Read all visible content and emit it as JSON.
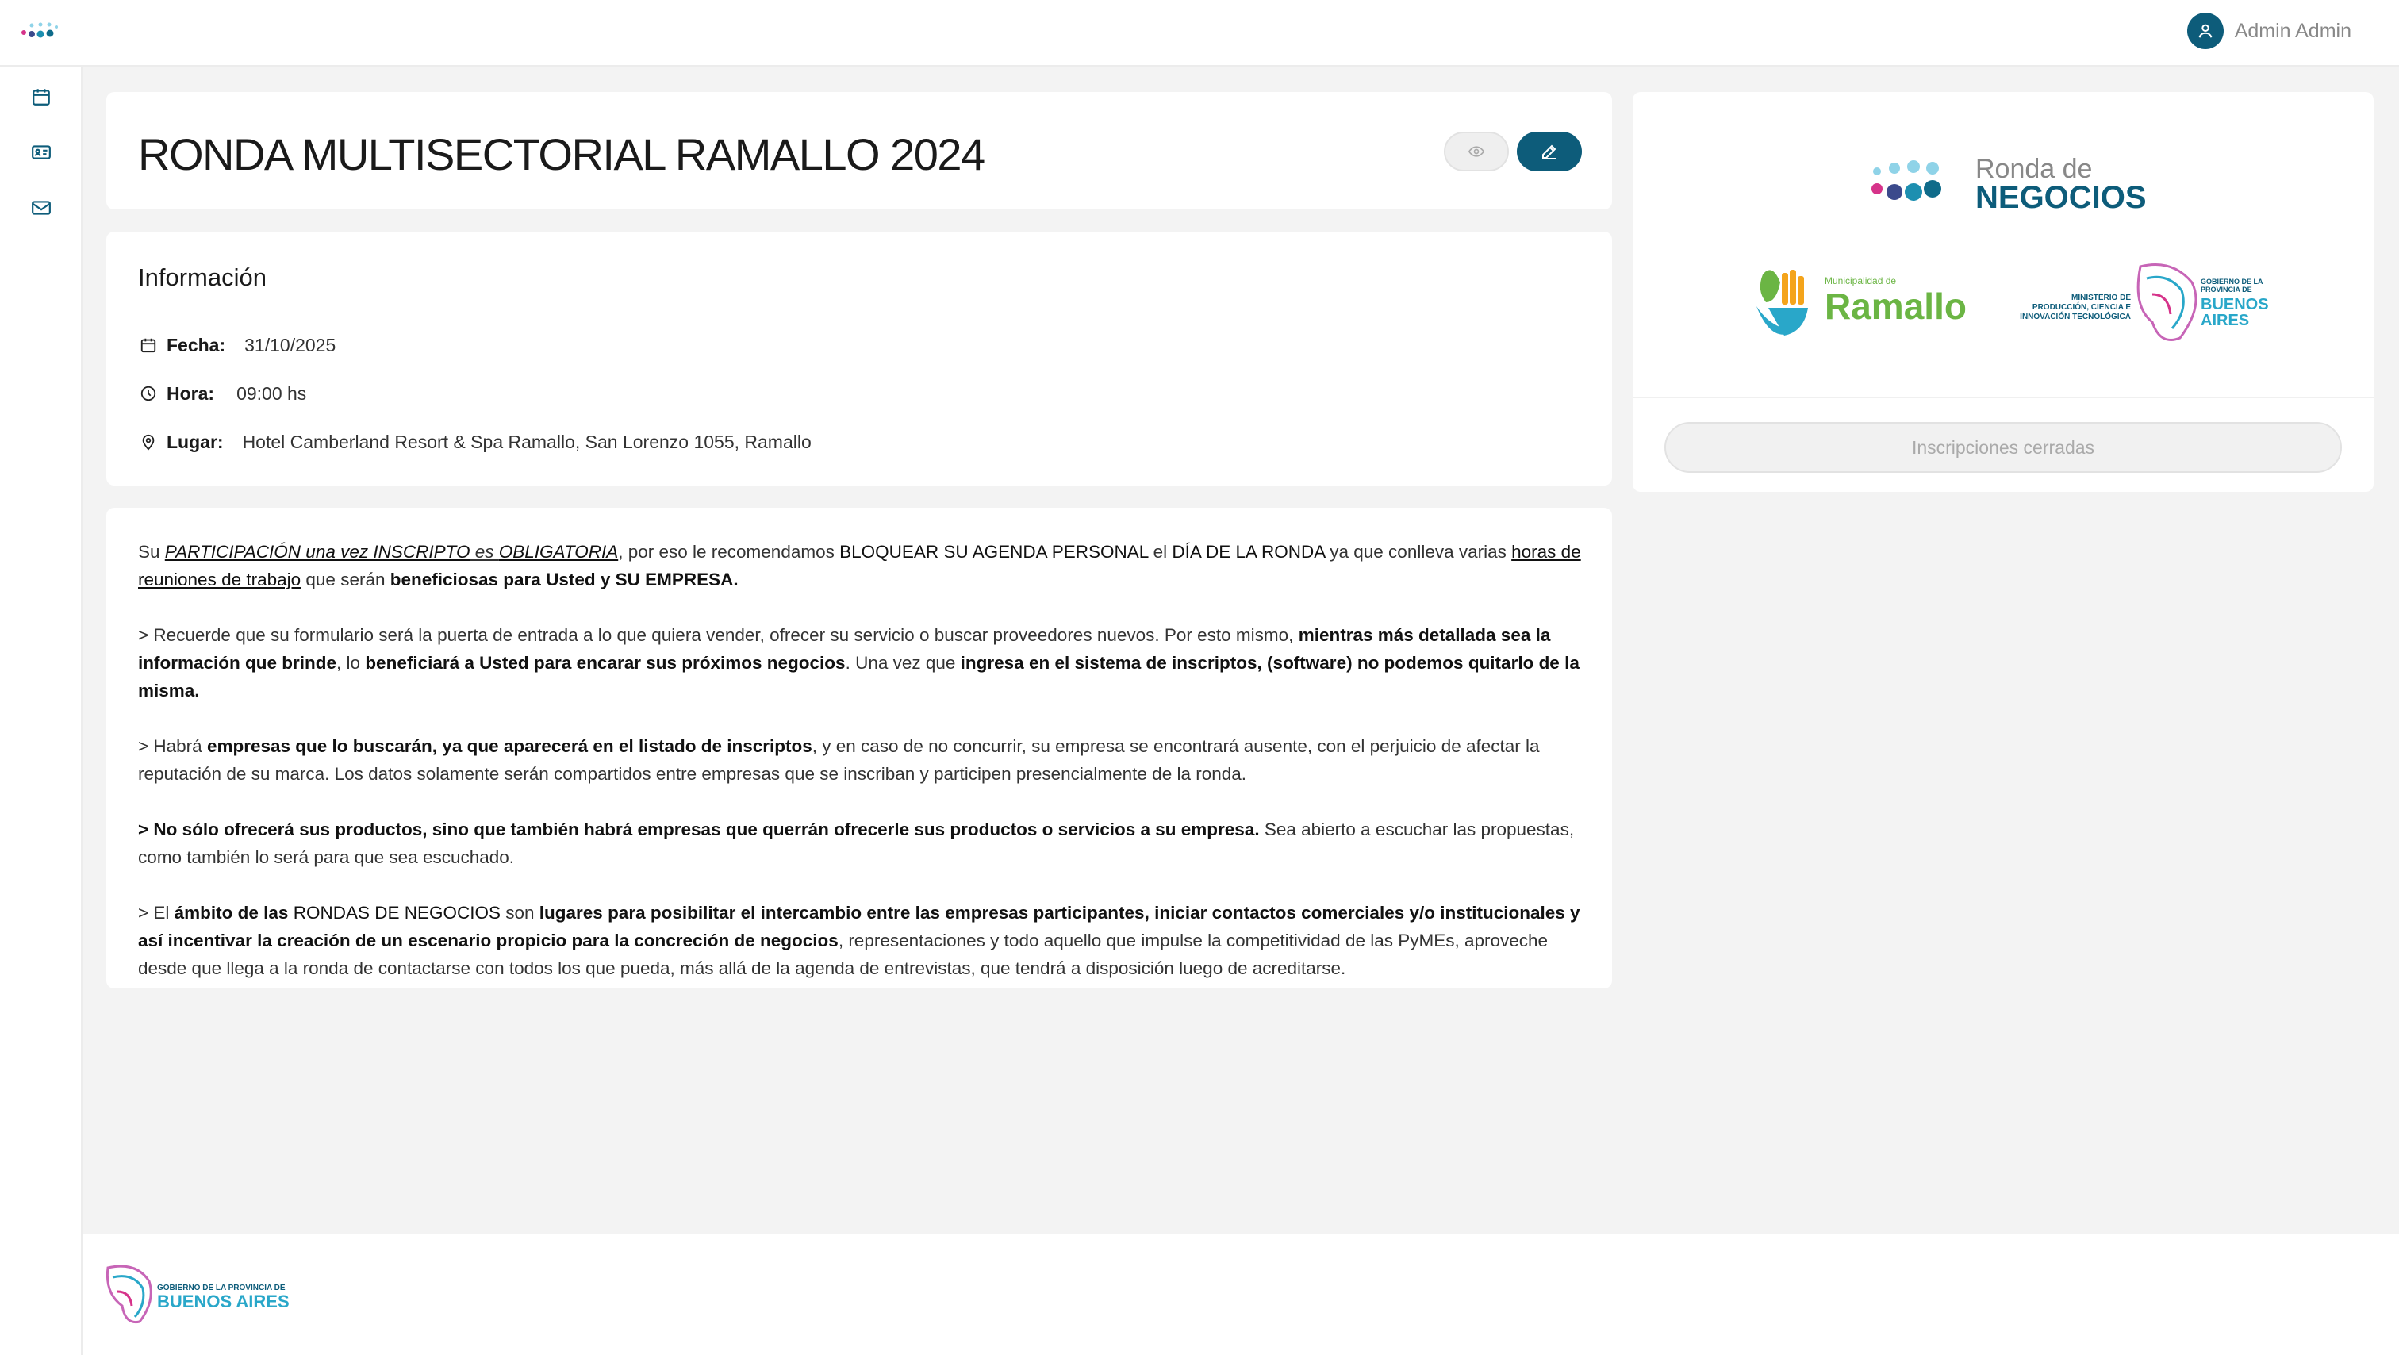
{
  "header": {
    "user_name": "Admin Admin",
    "user_icon": "user-icon",
    "logo_icon": "app-dots-logo"
  },
  "sidebar": {
    "items": [
      {
        "name": "calendar",
        "icon": "calendar-icon"
      },
      {
        "name": "id-card",
        "icon": "id-card-icon"
      },
      {
        "name": "mail",
        "icon": "mail-icon"
      }
    ]
  },
  "event": {
    "title": "RONDA MULTISECTORIAL RAMALLO 2024",
    "view_icon": "eye-icon",
    "edit_icon": "pencil-icon"
  },
  "info": {
    "heading": "Información",
    "fecha_label": "Fecha:",
    "fecha_value": "31/10/2025",
    "hora_label": "Hora:",
    "hora_value": "09:00 hs",
    "lugar_label": "Lugar:",
    "lugar_value": "Hotel Camberland Resort & Spa Ramallo, San Lorenzo 1055, Ramallo"
  },
  "description": {
    "p1": {
      "a": "Su ",
      "b": "PARTICIPACIÓN una vez INSCRIPTO",
      "c": " es ",
      "d": "OBLIGATORIA",
      "e": ", por eso le recomendamos ",
      "f": "BLOQUEAR SU AGENDA PERSONAL",
      "g": " el ",
      "h": "DÍA DE LA RONDA",
      "i": " ya que conlleva varias ",
      "j": "horas de reuniones de trabajo",
      "k": " que serán ",
      "l": "beneficiosas para Usted y SU EMPRESA."
    },
    "p2": {
      "a": "> Recuerde que su formulario será la puerta de entrada a lo que quiera vender, ofrecer su servicio o buscar proveedores nuevos. Por esto mismo, ",
      "b": "mientras más detallada sea la información que brinde",
      "c": ", lo ",
      "d": "beneficiará a Usted para encarar sus próximos negocios",
      "e": ". Una vez que ",
      "f": "ingresa en el sistema de inscriptos, (software) no podemos quitarlo de la misma."
    },
    "p3": {
      "a": "> Habrá ",
      "b": "empresas que lo buscarán, ya que aparecerá en el listado de inscriptos",
      "c": ", y en caso de no concurrir, su empresa se encontrará ausente, con el perjuicio de afectar la reputación de su marca. Los datos solamente serán compartidos entre empresas que se inscriban y participen presencialmente de la ronda."
    },
    "p4": {
      "a": "> No sólo ofrecerá sus productos, sino que también habrá empresas que querrán ofrecerle sus productos o servicios a su empresa.",
      "b": " Sea abierto a escuchar las propuestas, como también lo será para que sea escuchado."
    },
    "p5": {
      "a": "> El ",
      "b": "ámbito de las",
      "c": " RONDAS DE NEGOCIOS ",
      "d": "son ",
      "e": "lugares para posibilitar el intercambio entre las empresas participantes, iniciar contactos comerciales y/o institucionales y así incentivar la creación de un escenario propicio para la concreción de negocios",
      "f": ", representaciones y todo aquello que impulse la competitividad de las PyMEs, aproveche desde que llega a la ronda de contactarse con todos los que pueda, más allá de la agenda de entrevistas, que tendrá a disposición luego de acreditarse."
    }
  },
  "logos": {
    "ronda_line1": "Ronda de",
    "ronda_line2": "NEGOCIOS",
    "municipalidad": "Municipalidad de",
    "ramallo": "Ramallo",
    "ministerio_1": "MINISTERIO DE",
    "ministerio_2": "PRODUCCIÓN, CIENCIA E",
    "ministerio_3": "INNOVACIÓN TECNOLÓGICA",
    "gobierno_1": "GOBIERNO DE LA",
    "gobierno_2": "PROVINCIA DE",
    "buenos": "BUENOS",
    "aires": "AIRES"
  },
  "registration": {
    "button_label": "Inscripciones cerradas"
  },
  "footer": {
    "gobierno": "GOBIERNO DE LA PROVINCIA DE",
    "buenos_aires": "BUENOS AIRES"
  },
  "colors": {
    "primary": "#0d5c7a",
    "ramallo_green": "#6bb544",
    "ba_blue": "#29a7c9"
  }
}
